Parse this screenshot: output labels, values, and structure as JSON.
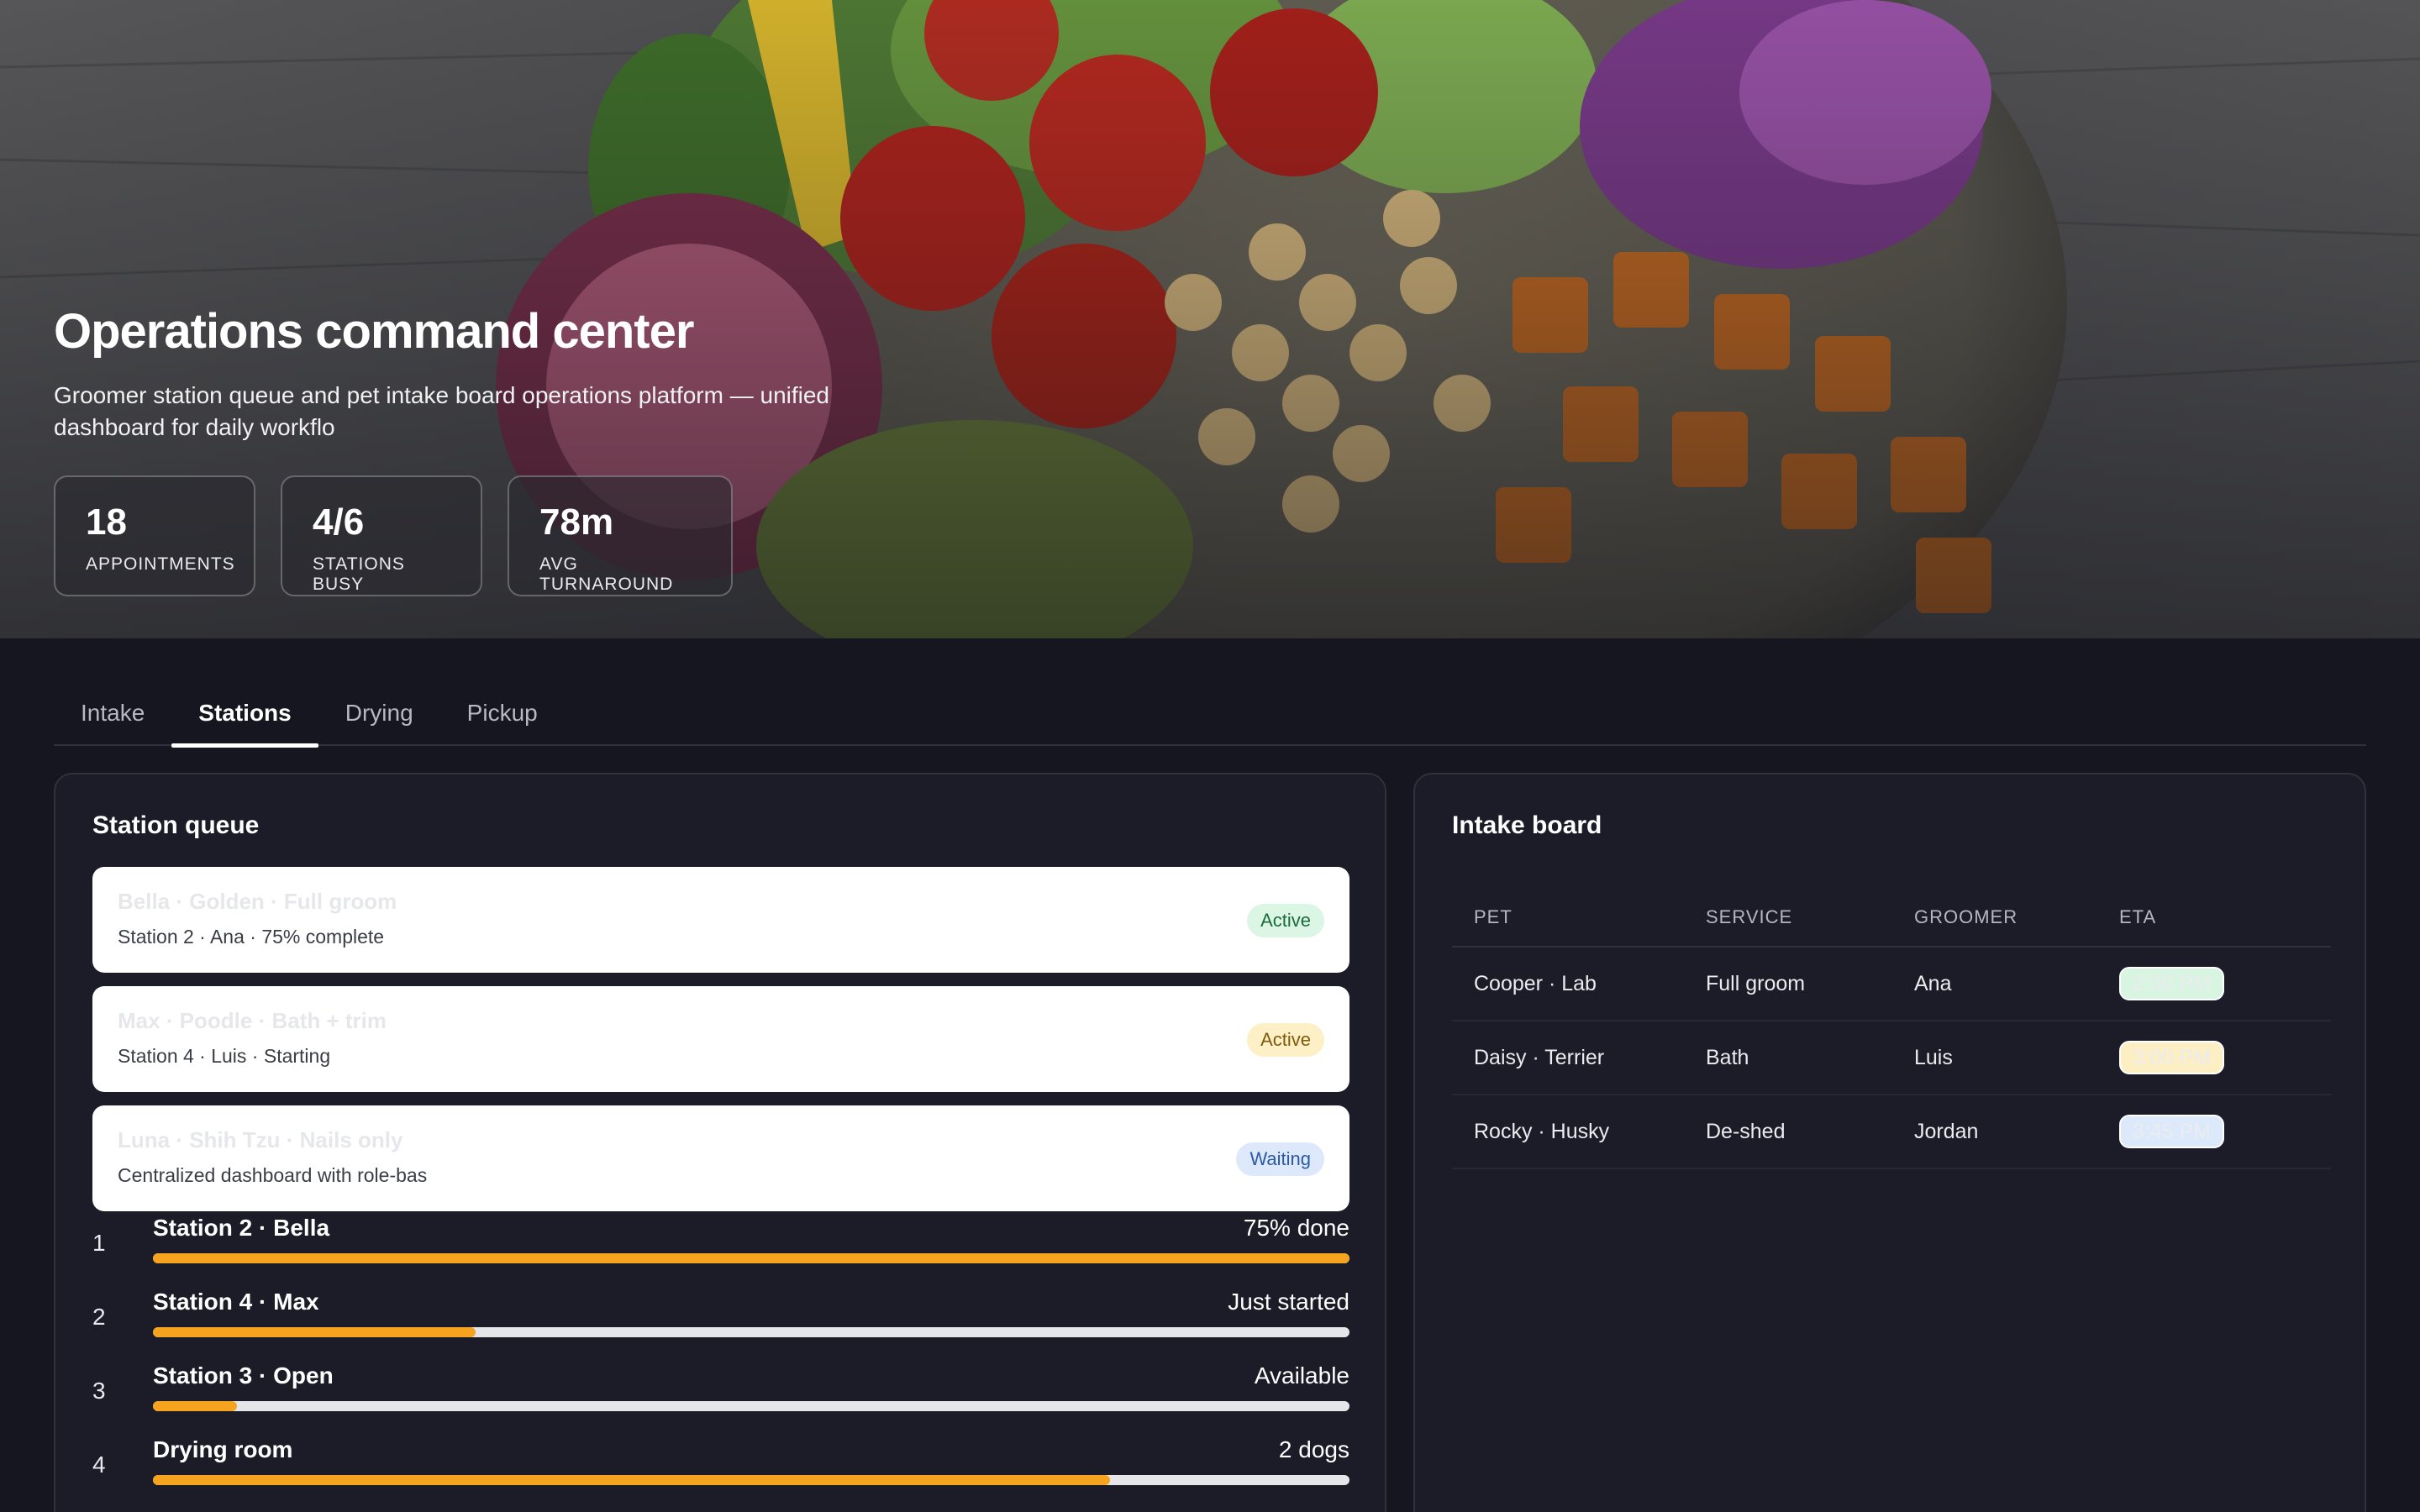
{
  "hero": {
    "title": "Operations command center",
    "subtitle": "Groomer station queue and pet intake board operations platform — unified dashboard for daily workflo",
    "kpis": [
      {
        "value": "18",
        "label": "APPOINTMENTS"
      },
      {
        "value": "4/6",
        "label": "STATIONS BUSY"
      },
      {
        "value": "78m",
        "label": "AVG TURNAROUND"
      }
    ]
  },
  "tabs": [
    {
      "label": "Intake",
      "active": false
    },
    {
      "label": "Stations",
      "active": true
    },
    {
      "label": "Drying",
      "active": false
    },
    {
      "label": "Pickup",
      "active": false
    }
  ],
  "station_queue": {
    "title": "Station queue",
    "cards": [
      {
        "title": "Bella · Golden · Full groom",
        "subtitle": "Station 2 · Ana · 75% complete",
        "badge": "Active"
      },
      {
        "title": "Max · Poodle · Bath + trim",
        "subtitle": "Station 4 · Luis · Starting",
        "badge": "Active"
      },
      {
        "title": "Luna · Shih Tzu · Nails only",
        "subtitle": "Centralized dashboard with role-bas",
        "badge": "Waiting"
      }
    ],
    "progress": [
      {
        "num": "1",
        "label": "Station 2 · Bella",
        "value": "75% done",
        "fill": 1.0
      },
      {
        "num": "2",
        "label": "Station 4 · Max",
        "value": "Just started",
        "fill": 0.27
      },
      {
        "num": "3",
        "label": "Station 3 · Open",
        "value": "Available",
        "fill": 0.07
      },
      {
        "num": "4",
        "label": "Drying room",
        "value": "2 dogs",
        "fill": 0.8
      }
    ]
  },
  "intake_board": {
    "title": "Intake board",
    "columns": [
      "PET",
      "SERVICE",
      "GROOMER",
      "ETA"
    ],
    "rows": [
      {
        "pet": "Cooper · Lab",
        "service": "Full groom",
        "groomer": "Ana",
        "eta": "2:30 PM"
      },
      {
        "pet": "Daisy · Terrier",
        "service": "Bath",
        "groomer": "Luis",
        "eta": "3:00 PM"
      },
      {
        "pet": "Rocky · Husky",
        "service": "De-shed",
        "groomer": "Jordan",
        "eta": "3:45 PM"
      }
    ]
  },
  "colors": {
    "background": "#15161f",
    "panel": "#1b1c27",
    "accent": "#f6a41f",
    "status_green": "#dcf6e5",
    "status_yellow": "#fdf0c6",
    "status_blue": "#dde9fb"
  }
}
